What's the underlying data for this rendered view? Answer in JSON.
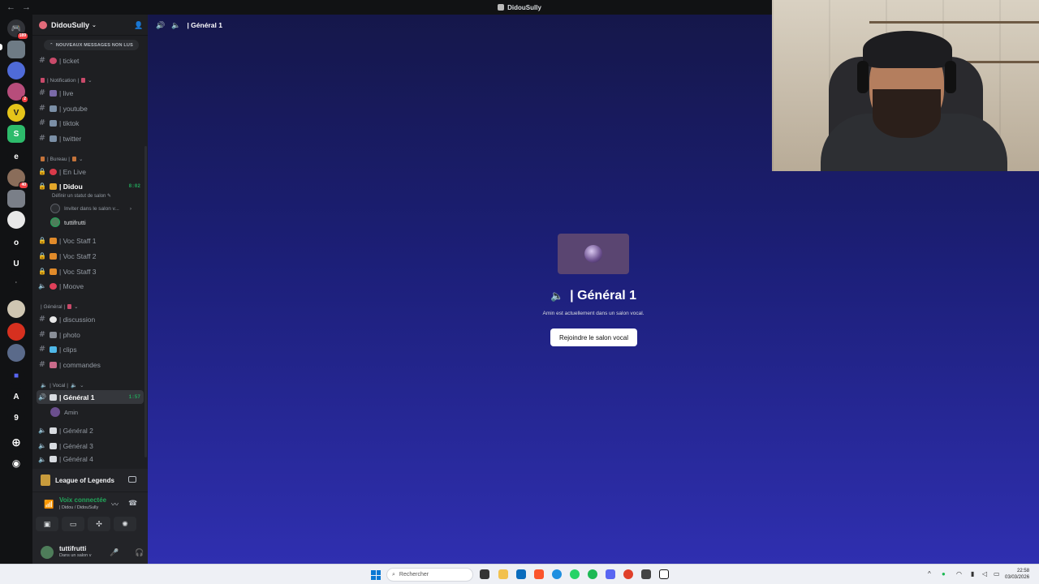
{
  "window": {
    "title": "DidouSully",
    "back": "←",
    "forward": "→"
  },
  "server": {
    "name": "DidouSully",
    "unread_banner": "NOUVEAUX MESSAGES NON LUS",
    "rail_badges": {
      "dm": "189",
      "s3": "2",
      "s10": "40"
    },
    "rail_letters": {
      "e": "e",
      "o": "o",
      "u": "U",
      "a": "A",
      "nine": "9"
    }
  },
  "channels": {
    "ticket": "| ticket",
    "cat_notification": "| Notification |",
    "live": "| live",
    "youtube": "| youtube",
    "tiktok": "| tiktok",
    "twitter": "| twitter",
    "cat_bureau": "| Bureau |",
    "en_live": "| En Live",
    "didou": "| Didou",
    "didou_timer": "8:02",
    "didou_status": "Définir un statut de salon",
    "invite": "Inviter dans le salon v...",
    "member_tuttifrutti": "tuttifrutti",
    "voc_staff_1": "| Voc Staff 1",
    "voc_staff_2": "| Voc Staff 2",
    "voc_staff_3": "| Voc Staff 3",
    "moove": "| Moove",
    "cat_general": "| Général |",
    "discussion": "| discussion",
    "photo": "| photo",
    "clips": "| clips",
    "commandes": "| commandes",
    "cat_vocal": "| Vocal |",
    "general1": "| Général 1",
    "general1_timer": "1:57",
    "member_amin": "Amin",
    "general2": "| Général 2",
    "general3": "| Général 3",
    "general4": "| Général 4"
  },
  "activity": {
    "game": "League of Legends"
  },
  "voice": {
    "status": "Voix connectée",
    "location": "| Didou / DidouSully"
  },
  "user": {
    "name": "tuttifrutti",
    "status": "Dans un salon v"
  },
  "main": {
    "header_title": "| Général 1",
    "channel_title": "| Général 1",
    "subtitle": "Amin est actuellement dans un salon vocal.",
    "join_button": "Rejoindre le salon vocal"
  },
  "taskbar": {
    "search_placeholder": "Rechercher",
    "time": "22:58",
    "date": "03/03/2026"
  },
  "colors": {
    "accent_green": "#23a55a",
    "brand": "#5865f2",
    "bg_gradient_top": "#15174a",
    "bg_gradient_bottom": "#2f2fb0"
  }
}
